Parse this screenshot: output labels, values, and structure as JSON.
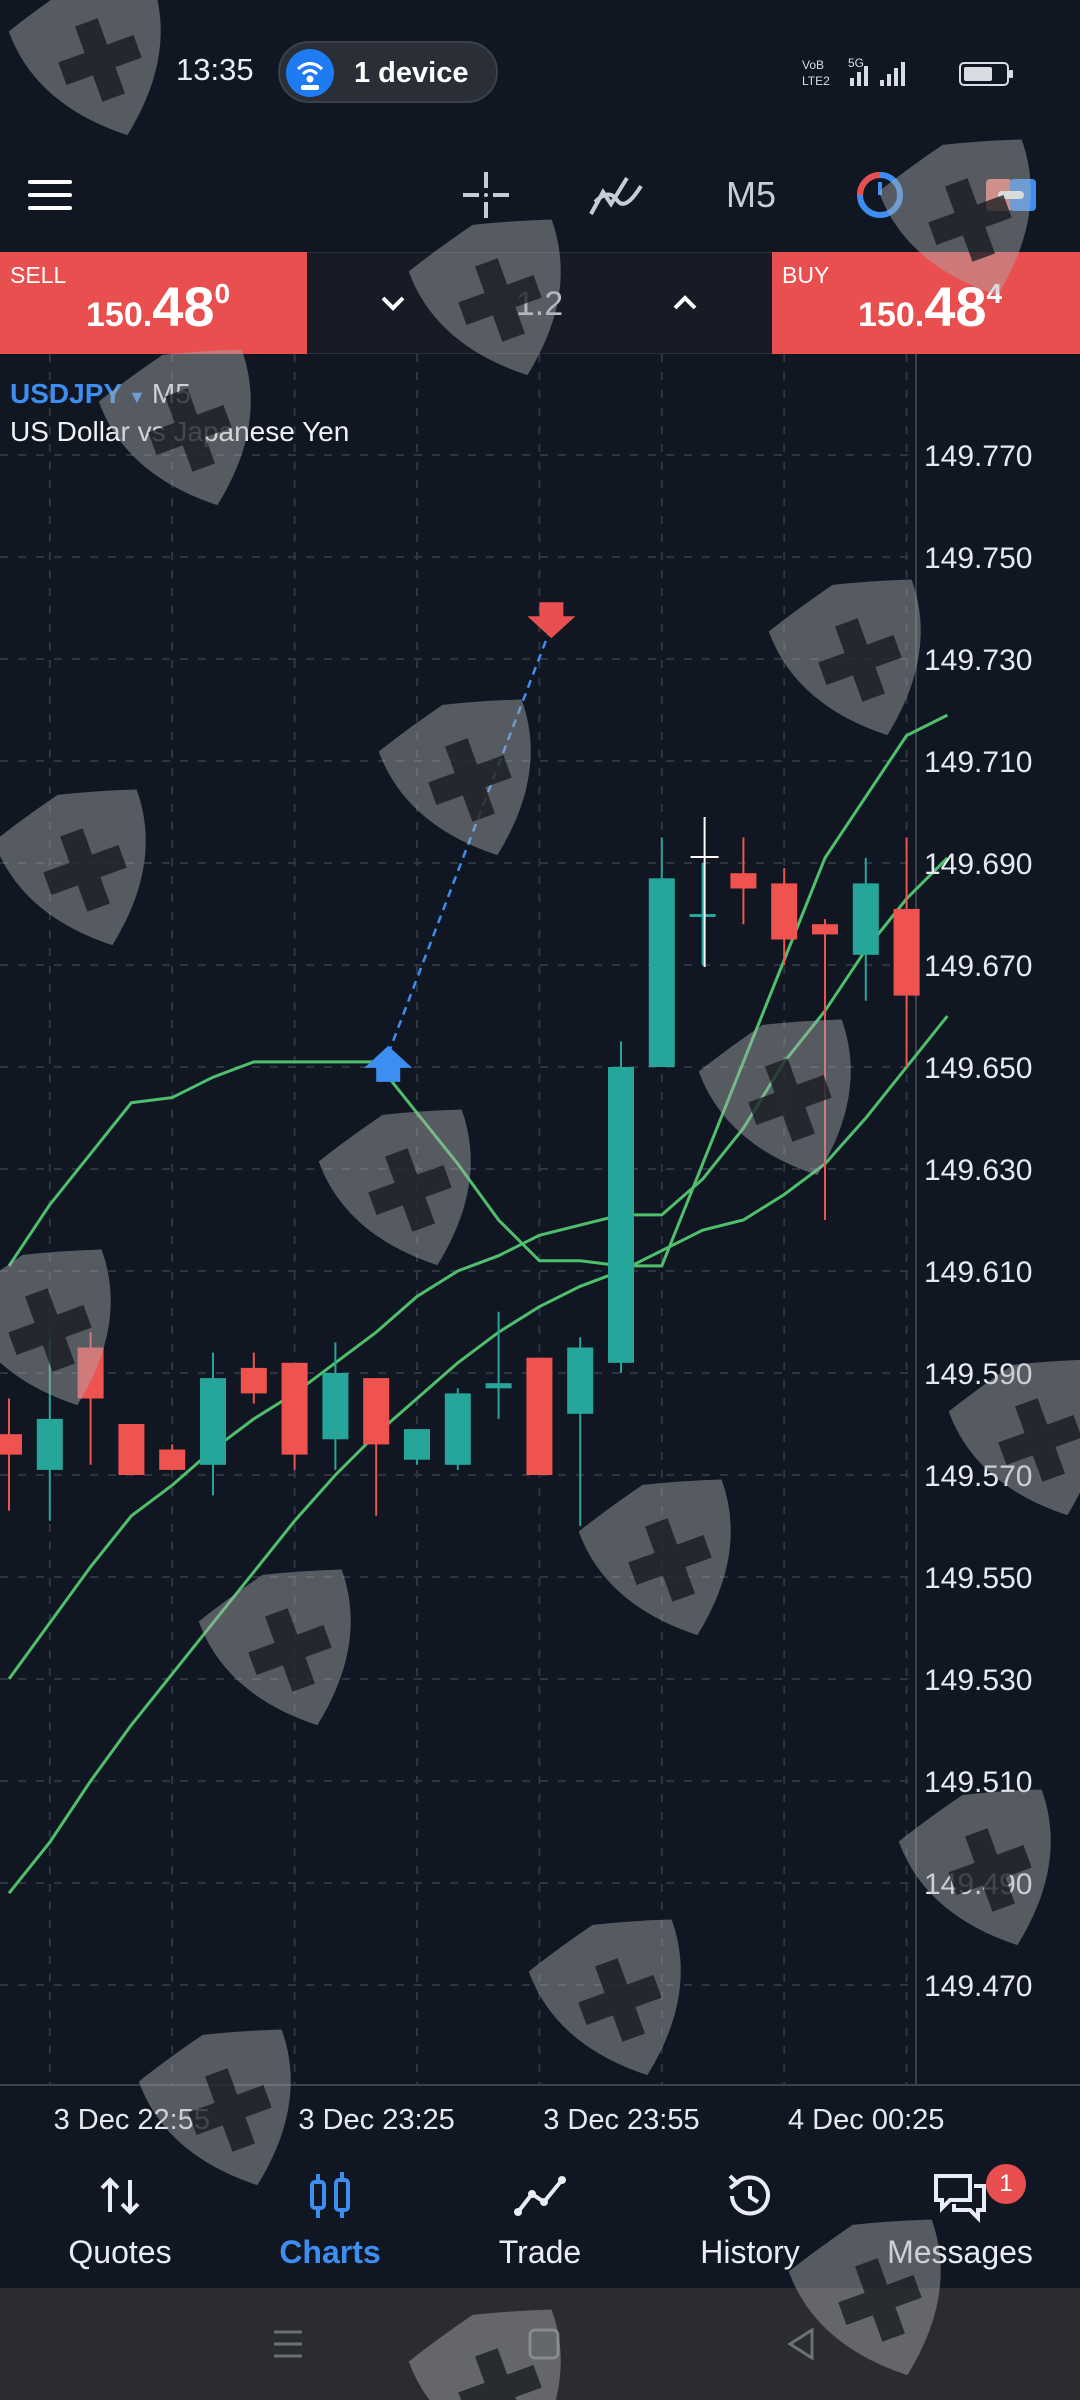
{
  "status_bar": {
    "time": "13:35",
    "device_pill": "1 device",
    "network": "5G",
    "network_detail": "VoLTE2",
    "icons": [
      "wifi-hotspot-icon",
      "signal-icon",
      "battery-icon"
    ]
  },
  "toolbar": {
    "menu_icon": "hamburger-menu-icon",
    "crosshair_icon": "crosshair-icon",
    "indicators_icon": "indicators-icon",
    "timeframe": "M5",
    "oneclick_icon": "one-click-trading-icon",
    "color_icon": "color-scheme-icon"
  },
  "trade_panel": {
    "sell_label": "SELL",
    "sell_price_prefix": "150.",
    "sell_price_big": "48",
    "sell_price_sup": "0",
    "buy_label": "BUY",
    "buy_price_prefix": "150.",
    "buy_price_big": "48",
    "buy_price_sup": "4",
    "lot_value": "1.2"
  },
  "chart_header": {
    "symbol": "USDJPY",
    "timeframe": "M5",
    "description": "US Dollar vs Japanese Yen"
  },
  "colors": {
    "background": "#111722",
    "bull": "#26a69a",
    "bear": "#ef5350",
    "band": "#4fbf6c",
    "accent": "#3d8ef0",
    "sell_buy": "#e94f4f"
  },
  "chart_data": {
    "type": "candlestick",
    "y_ticks": [
      149.77,
      149.75,
      149.73,
      149.71,
      149.69,
      149.67,
      149.65,
      149.63,
      149.61,
      149.59,
      149.57,
      149.55,
      149.53,
      149.51,
      149.49,
      149.47
    ],
    "ylim": [
      149.462,
      149.8
    ],
    "x_tick_labels": [
      "3 Dec 22:55",
      "3 Dec 23:25",
      "3 Dec 23:55",
      "4 Dec 00:25"
    ],
    "x_tick_indices": [
      1,
      7,
      13,
      19
    ],
    "grid": true,
    "candles": [
      {
        "o": 149.578,
        "h": 149.585,
        "l": 149.563,
        "c": 149.574
      },
      {
        "o": 149.571,
        "h": 149.597,
        "l": 149.561,
        "c": 149.581
      },
      {
        "o": 149.595,
        "h": 149.598,
        "l": 149.572,
        "c": 149.585
      },
      {
        "o": 149.58,
        "h": 149.58,
        "l": 149.57,
        "c": 149.57
      },
      {
        "o": 149.575,
        "h": 149.576,
        "l": 149.571,
        "c": 149.571
      },
      {
        "o": 149.572,
        "h": 149.594,
        "l": 149.566,
        "c": 149.589
      },
      {
        "o": 149.591,
        "h": 149.594,
        "l": 149.584,
        "c": 149.586
      },
      {
        "o": 149.592,
        "h": 149.592,
        "l": 149.571,
        "c": 149.574
      },
      {
        "o": 149.577,
        "h": 149.596,
        "l": 149.571,
        "c": 149.59
      },
      {
        "o": 149.589,
        "h": 149.589,
        "l": 149.562,
        "c": 149.576
      },
      {
        "o": 149.573,
        "h": 149.579,
        "l": 149.572,
        "c": 149.579
      },
      {
        "o": 149.572,
        "h": 149.587,
        "l": 149.571,
        "c": 149.586
      },
      {
        "o": 149.587,
        "h": 149.602,
        "l": 149.581,
        "c": 149.588
      },
      {
        "o": 149.593,
        "h": 149.593,
        "l": 149.57,
        "c": 149.57
      },
      {
        "o": 149.582,
        "h": 149.597,
        "l": 149.56,
        "c": 149.595
      },
      {
        "o": 149.592,
        "h": 149.655,
        "l": 149.59,
        "c": 149.65
      },
      {
        "o": 149.65,
        "h": 149.695,
        "l": 149.65,
        "c": 149.687
      },
      {
        "o": 149.68,
        "h": 149.69,
        "l": 149.67,
        "c": 149.68
      },
      {
        "o": 149.688,
        "h": 149.695,
        "l": 149.678,
        "c": 149.685
      },
      {
        "o": 149.686,
        "h": 149.689,
        "l": 149.67,
        "c": 149.675
      },
      {
        "o": 149.678,
        "h": 149.679,
        "l": 149.62,
        "c": 149.676
      },
      {
        "o": 149.672,
        "h": 149.691,
        "l": 149.663,
        "c": 149.686
      },
      {
        "o": 149.681,
        "h": 149.695,
        "l": 149.65,
        "c": 149.664
      }
    ],
    "bands": [
      {
        "name": "upper",
        "values": [
          149.611,
          149.623,
          149.633,
          149.643,
          149.644,
          149.648,
          149.651,
          149.651,
          149.651,
          149.651,
          149.641,
          149.631,
          149.62,
          149.612,
          149.612,
          149.611,
          149.611,
          149.631,
          149.651,
          149.671,
          149.691,
          149.703,
          149.715,
          149.719
        ]
      },
      {
        "name": "middle",
        "values": [
          149.53,
          149.541,
          149.552,
          149.562,
          149.568,
          149.575,
          149.581,
          149.586,
          149.592,
          149.598,
          149.605,
          149.61,
          149.613,
          149.617,
          149.619,
          149.621,
          149.621,
          149.628,
          149.638,
          149.651,
          149.661,
          149.673,
          149.683,
          149.691
        ]
      },
      {
        "name": "lower",
        "values": [
          149.488,
          149.498,
          149.51,
          149.521,
          149.531,
          149.541,
          149.551,
          149.561,
          149.57,
          149.578,
          149.585,
          149.592,
          149.598,
          149.603,
          149.607,
          149.61,
          149.614,
          149.618,
          149.62,
          149.625,
          149.631,
          149.64,
          149.65,
          149.66
        ]
      }
    ],
    "trade_arrows": [
      {
        "type": "buy",
        "price": 149.651,
        "index": 9
      },
      {
        "type": "sell",
        "price": 149.738,
        "index": 13
      }
    ],
    "crosshair": {
      "index": 17,
      "price": 149.69
    }
  },
  "bottom_nav": [
    {
      "label": "Quotes",
      "icon": "quotes-icon",
      "active": false
    },
    {
      "label": "Charts",
      "icon": "charts-icon",
      "active": true
    },
    {
      "label": "Trade",
      "icon": "trade-icon",
      "active": false
    },
    {
      "label": "History",
      "icon": "history-icon",
      "active": false
    },
    {
      "label": "Messages",
      "icon": "messages-icon",
      "active": false,
      "badge": "1"
    }
  ],
  "system_nav": {
    "icons": [
      "recent-apps-icon",
      "home-icon",
      "back-icon"
    ]
  }
}
